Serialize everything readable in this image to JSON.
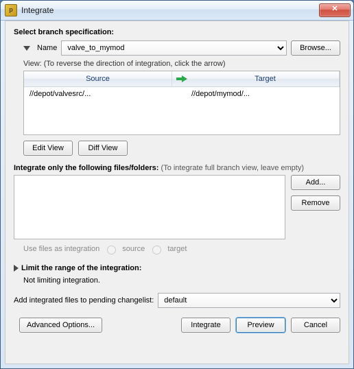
{
  "window": {
    "title": "Integrate",
    "close_glyph": "✕"
  },
  "branch": {
    "header": "Select branch specification:",
    "name_label": "Name",
    "name_value": "valve_to_mymod",
    "browse": "Browse...",
    "view_hint": "View: (To reverse the direction of integration, click the arrow)",
    "col_source": "Source",
    "col_target": "Target",
    "rows": [
      {
        "source": "//depot/valvesrc/...",
        "target": "//depot/mymod/..."
      }
    ],
    "edit_view": "Edit View",
    "diff_view": "Diff View"
  },
  "files": {
    "header": "Integrate only the following files/folders:",
    "note": "(To integrate full branch view, leave empty)",
    "add": "Add...",
    "remove": "Remove",
    "use_as": "Use files as integration",
    "opt_source": "source",
    "opt_target": "target"
  },
  "limit": {
    "header": "Limit the range of the integration:",
    "status": "Not limiting integration."
  },
  "changelist": {
    "label": "Add integrated files to pending changelist:",
    "value": "default"
  },
  "footer": {
    "advanced": "Advanced Options...",
    "integrate": "Integrate",
    "preview": "Preview",
    "cancel": "Cancel"
  }
}
